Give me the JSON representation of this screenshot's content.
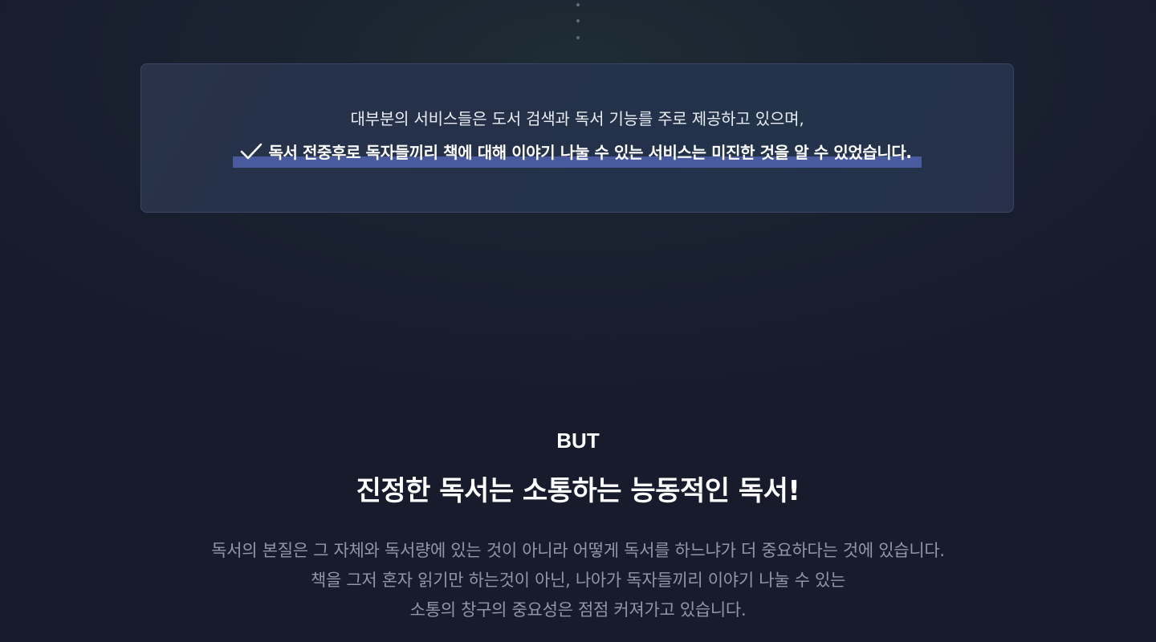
{
  "top_dots_count": 3,
  "card": {
    "line1": "대부분의 서비스들은 도서 검색과 독서 기능를 주로 제공하고 있으며,",
    "line2": "독서 전중후로 독자들끼리 책에 대해 이야기 나눌 수 있는 서비스는 미진한 것을 알 수 있었습니다.",
    "check_icon": "check-icon",
    "highlight_color": "#4a5a9e"
  },
  "section": {
    "eyebrow": "BUT",
    "headline": "진정한 독서는 소통하는 능동적인 독서!",
    "body_lines": [
      "독서의 본질은 그 자체와 독서량에 있는 것이 아니라 어떻게 독서를 하느냐가 더 중요하다는 것에 있습니다.",
      "책을 그저 혼자 읽기만 하는것이 아닌, 나아가 독자들끼리 이야기 나눌 수 있는",
      "소통의 창구의 중요성은 점점 커져가고 있습니다."
    ]
  },
  "colors": {
    "background": "#171b2c",
    "card_border": "#3b4662",
    "body_text": "#9097a8"
  }
}
